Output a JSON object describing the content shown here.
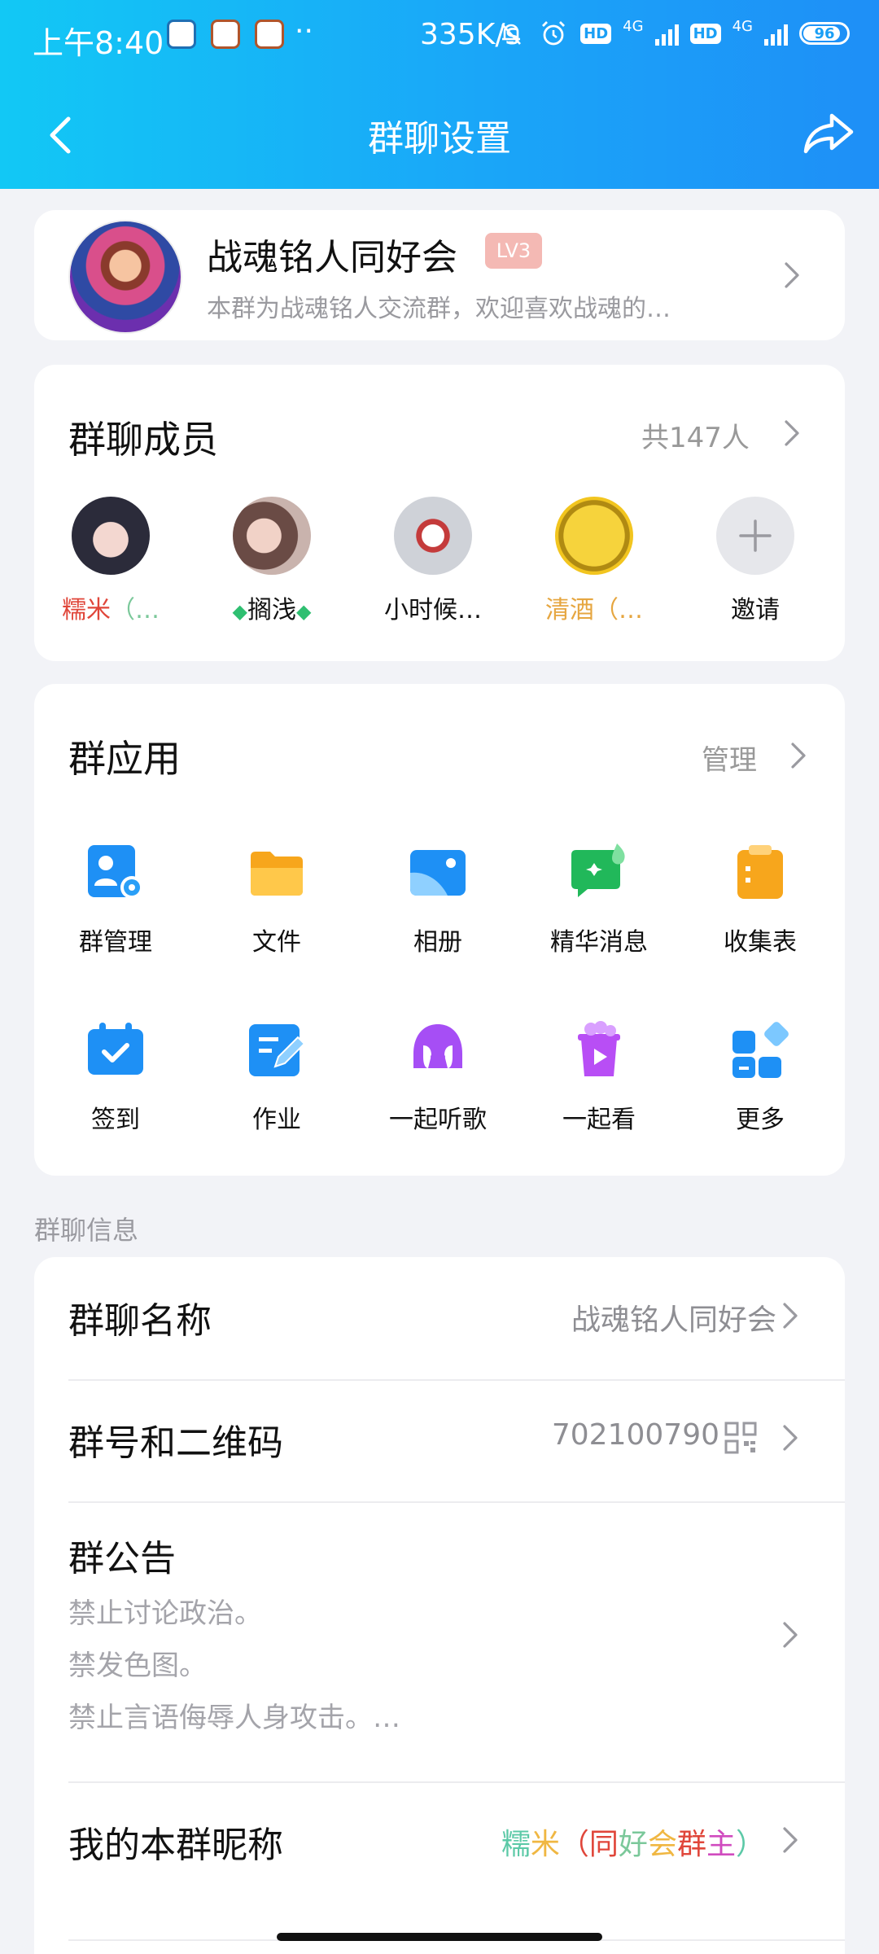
{
  "status_bar": {
    "time": "上午8:40",
    "dots": "··",
    "speed": "335K/s",
    "hd1": "HD",
    "net1": "4G",
    "hd2": "HD",
    "net2": "4G",
    "battery": "96"
  },
  "nav": {
    "title": "群聊设置"
  },
  "group": {
    "name": "战魂铭人同好会",
    "level": "LV3",
    "description": "本群为战魂铭人交流群，欢迎喜欢战魂的…"
  },
  "members": {
    "title": "群聊成员",
    "count": "共147人",
    "list": [
      {
        "name_a": "糯米",
        "name_b": "（…"
      },
      {
        "name_pre": "◆",
        "name": "搁浅",
        "name_post": "◆"
      },
      {
        "name": "小时候…"
      },
      {
        "name": "清酒（…"
      },
      {
        "name": "邀请"
      }
    ]
  },
  "apps": {
    "title": "群应用",
    "manage": "管理",
    "items": [
      {
        "label": "群管理",
        "icon": "group-manage-icon"
      },
      {
        "label": "文件",
        "icon": "folder-icon"
      },
      {
        "label": "相册",
        "icon": "album-icon"
      },
      {
        "label": "精华消息",
        "icon": "essence-message-icon"
      },
      {
        "label": "收集表",
        "icon": "collection-form-icon"
      },
      {
        "label": "签到",
        "icon": "check-in-icon"
      },
      {
        "label": "作业",
        "icon": "homework-icon"
      },
      {
        "label": "一起听歌",
        "icon": "listen-together-icon"
      },
      {
        "label": "一起看",
        "icon": "watch-together-icon"
      },
      {
        "label": "更多",
        "icon": "more-apps-icon"
      }
    ]
  },
  "info": {
    "section_label": "群聊信息",
    "group_name_label": "群聊名称",
    "group_name_value": "战魂铭人同好会",
    "group_number_label": "群号和二维码",
    "group_number_value": "702100790",
    "notice_label": "群公告",
    "notice_lines": [
      "禁止讨论政治。",
      "禁发色图。",
      "禁止言语侮辱人身攻击。…"
    ],
    "nickname_label": "我的本群昵称",
    "nickname_parts": [
      "糯",
      "米",
      "（",
      "同",
      "好",
      "会",
      "群",
      "主",
      "）"
    ]
  },
  "colors": {
    "header_start": "#12c8f5",
    "header_end": "#1e8ff7",
    "lv_badge": "#f4b9b4",
    "member1_red": "#e0463a",
    "member1_green": "#7bc89a",
    "member4_gold": "#e6a640"
  }
}
